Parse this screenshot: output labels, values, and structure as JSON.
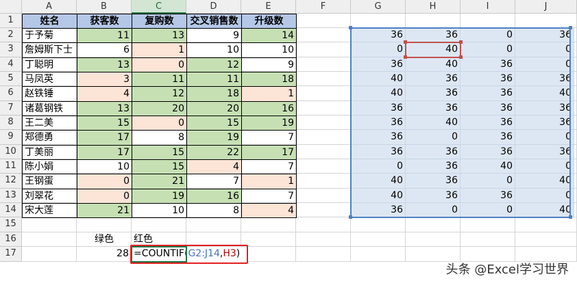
{
  "columns": [
    "A",
    "B",
    "C",
    "D",
    "E",
    "F",
    "G",
    "H",
    "I",
    "J"
  ],
  "active_column": "C",
  "rows": [
    1,
    2,
    3,
    4,
    5,
    6,
    7,
    8,
    9,
    10,
    11,
    12,
    13,
    14,
    15,
    16,
    17
  ],
  "table_headers": [
    "姓名",
    "获客数",
    "复购数",
    "交叉销售数",
    "升级数"
  ],
  "table_rows": [
    {
      "name": "于予菊",
      "b": "11",
      "c": "13",
      "d": "9",
      "e": "14",
      "bc": "g",
      "cc": "g",
      "dc": "w",
      "ec": "g"
    },
    {
      "name": "詹姆斯下士",
      "b": "6",
      "c": "1",
      "d": "10",
      "e": "10",
      "bc": "w",
      "cc": "r",
      "dc": "w",
      "ec": "w"
    },
    {
      "name": "丁聪明",
      "b": "13",
      "c": "0",
      "d": "12",
      "e": "9",
      "bc": "g",
      "cc": "r",
      "dc": "g",
      "ec": "w"
    },
    {
      "name": "马凤英",
      "b": "3",
      "c": "11",
      "d": "11",
      "e": "18",
      "bc": "r",
      "cc": "g",
      "dc": "g",
      "ec": "g"
    },
    {
      "name": "赵铁锤",
      "b": "4",
      "c": "12",
      "d": "18",
      "e": "1",
      "bc": "r",
      "cc": "g",
      "dc": "g",
      "ec": "r"
    },
    {
      "name": "诸葛钢铁",
      "b": "13",
      "c": "20",
      "d": "20",
      "e": "16",
      "bc": "g",
      "cc": "g",
      "dc": "g",
      "ec": "g"
    },
    {
      "name": "王二美",
      "b": "15",
      "c": "0",
      "d": "15",
      "e": "19",
      "bc": "g",
      "cc": "r",
      "dc": "g",
      "ec": "g"
    },
    {
      "name": "郑德勇",
      "b": "17",
      "c": "8",
      "d": "19",
      "e": "7",
      "bc": "g",
      "cc": "w",
      "dc": "g",
      "ec": "w"
    },
    {
      "name": "丁美丽",
      "b": "17",
      "c": "15",
      "d": "22",
      "e": "17",
      "bc": "g",
      "cc": "g",
      "dc": "g",
      "ec": "g"
    },
    {
      "name": "陈小娟",
      "b": "10",
      "c": "15",
      "d": "4",
      "e": "7",
      "bc": "w",
      "cc": "g",
      "dc": "r",
      "ec": "w"
    },
    {
      "name": "王钢蛋",
      "b": "0",
      "c": "21",
      "d": "7",
      "e": "1",
      "bc": "r",
      "cc": "g",
      "dc": "w",
      "ec": "r"
    },
    {
      "name": "刘翠花",
      "b": "0",
      "c": "19",
      "d": "16",
      "e": "7",
      "bc": "r",
      "cc": "g",
      "dc": "g",
      "ec": "w"
    },
    {
      "name": "宋大莲",
      "b": "21",
      "c": "10",
      "d": "8",
      "e": "4",
      "bc": "g",
      "cc": "w",
      "dc": "w",
      "ec": "r"
    }
  ],
  "right_values": [
    [
      "36",
      "36",
      "0",
      "36"
    ],
    [
      "0",
      "40",
      "0",
      "0"
    ],
    [
      "36",
      "40",
      "36",
      "0"
    ],
    [
      "40",
      "36",
      "36",
      "36"
    ],
    [
      "40",
      "36",
      "36",
      "40"
    ],
    [
      "36",
      "36",
      "36",
      "36"
    ],
    [
      "36",
      "40",
      "36",
      "36"
    ],
    [
      "36",
      "0",
      "36",
      "0"
    ],
    [
      "36",
      "36",
      "36",
      "36"
    ],
    [
      "0",
      "36",
      "40",
      "0"
    ],
    [
      "40",
      "36",
      "0",
      "40"
    ],
    [
      "40",
      "36",
      "36",
      "0"
    ],
    [
      "36",
      "0",
      "0",
      "40"
    ]
  ],
  "row16": {
    "b": "绿色",
    "c": "红色"
  },
  "row17": {
    "b": "28",
    "formula_prefix": "=COUNTIF(",
    "formula_range": "G2:J14",
    "formula_sep": ",",
    "formula_ref": "H3",
    "formula_suffix": ")"
  },
  "watermark": "头条 @Excel学习世界",
  "colors": {
    "green": "#c6e0b4",
    "red": "#fce4d6",
    "header_blue": "#b4c7e7",
    "selection": "#dde7f3"
  }
}
